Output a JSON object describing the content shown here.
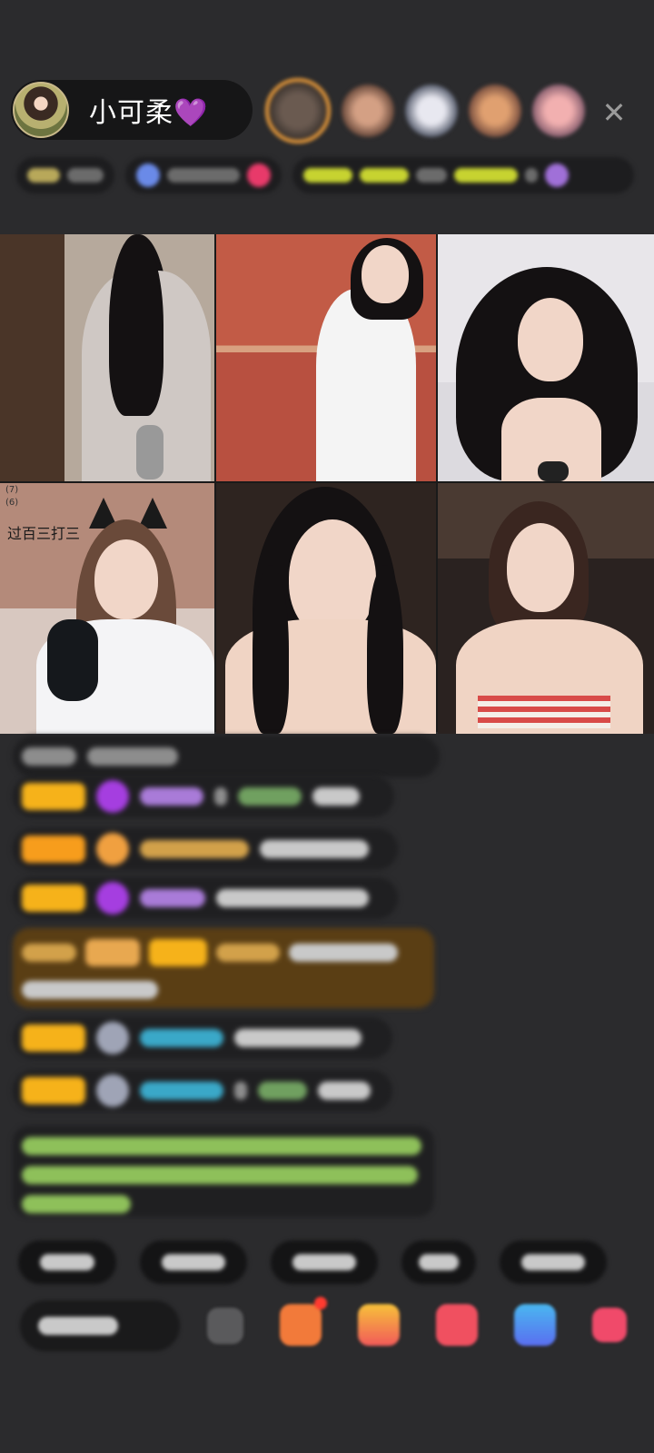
{
  "header": {
    "host_name": "小可柔",
    "host_heart": "💜",
    "close_icon": "✕"
  },
  "grid": {
    "cell4_label": "过百三打三",
    "cell4_mini_1": "(7)",
    "cell4_mini_2": "(6)"
  },
  "colors": {
    "background": "#2b2b2d",
    "badge_gold": "#f6b21a",
    "accent_purple": "#a53ee0"
  }
}
